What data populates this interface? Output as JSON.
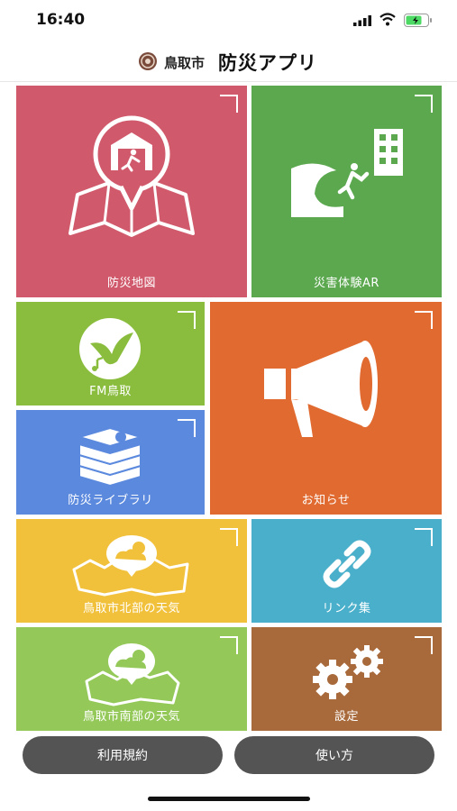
{
  "status_bar": {
    "time": "16:40"
  },
  "header": {
    "city": "鳥取市",
    "app_name": "防災アプリ"
  },
  "tiles": {
    "map": {
      "label": "防災地図",
      "color": "#d05a6c"
    },
    "ar": {
      "label": "災害体験AR",
      "color": "#5ba84f"
    },
    "fm": {
      "label": "FM鳥取",
      "color": "#8abd3e"
    },
    "news": {
      "label": "お知らせ",
      "color": "#e06a2f"
    },
    "library": {
      "label": "防災ライブラリ",
      "color": "#5b89de"
    },
    "weather_north": {
      "label": "鳥取市北部の天気",
      "color": "#f2c13c"
    },
    "links": {
      "label": "リンク集",
      "color": "#4aafca"
    },
    "weather_south": {
      "label": "鳥取市南部の天気",
      "color": "#94c95a"
    },
    "settings": {
      "label": "設定",
      "color": "#a86a3b"
    }
  },
  "footer": {
    "terms_label": "利用規約",
    "howto_label": "使い方"
  }
}
